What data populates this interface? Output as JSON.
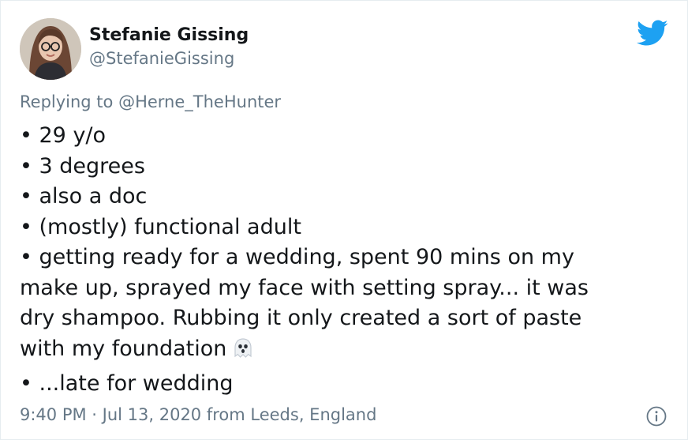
{
  "author": {
    "name": "Stefanie Gissing",
    "handle": "@StefanieGissing"
  },
  "reply": {
    "prefix": "Replying to ",
    "to_handle": "@Herne_TheHunter"
  },
  "tweet": {
    "lines": [
      "• 29 y/o",
      "• 3 degrees",
      "• also a doc",
      "• (mostly) functional adult",
      "• getting ready for a wedding, spent 90 mins on my",
      "make up, sprayed my face with setting spray... it was",
      "dry shampoo. Rubbing it only created a sort of paste",
      "with my foundation",
      "• ...late for wedding"
    ],
    "emoji": "ghost"
  },
  "meta": {
    "timestamp": "9:40 PM · Jul 13, 2020 from Leeds, England"
  },
  "icons": {
    "brand": "twitter-bird-icon",
    "info": "info-icon",
    "brand_color": "#1da1f2",
    "muted_color": "#657786"
  }
}
